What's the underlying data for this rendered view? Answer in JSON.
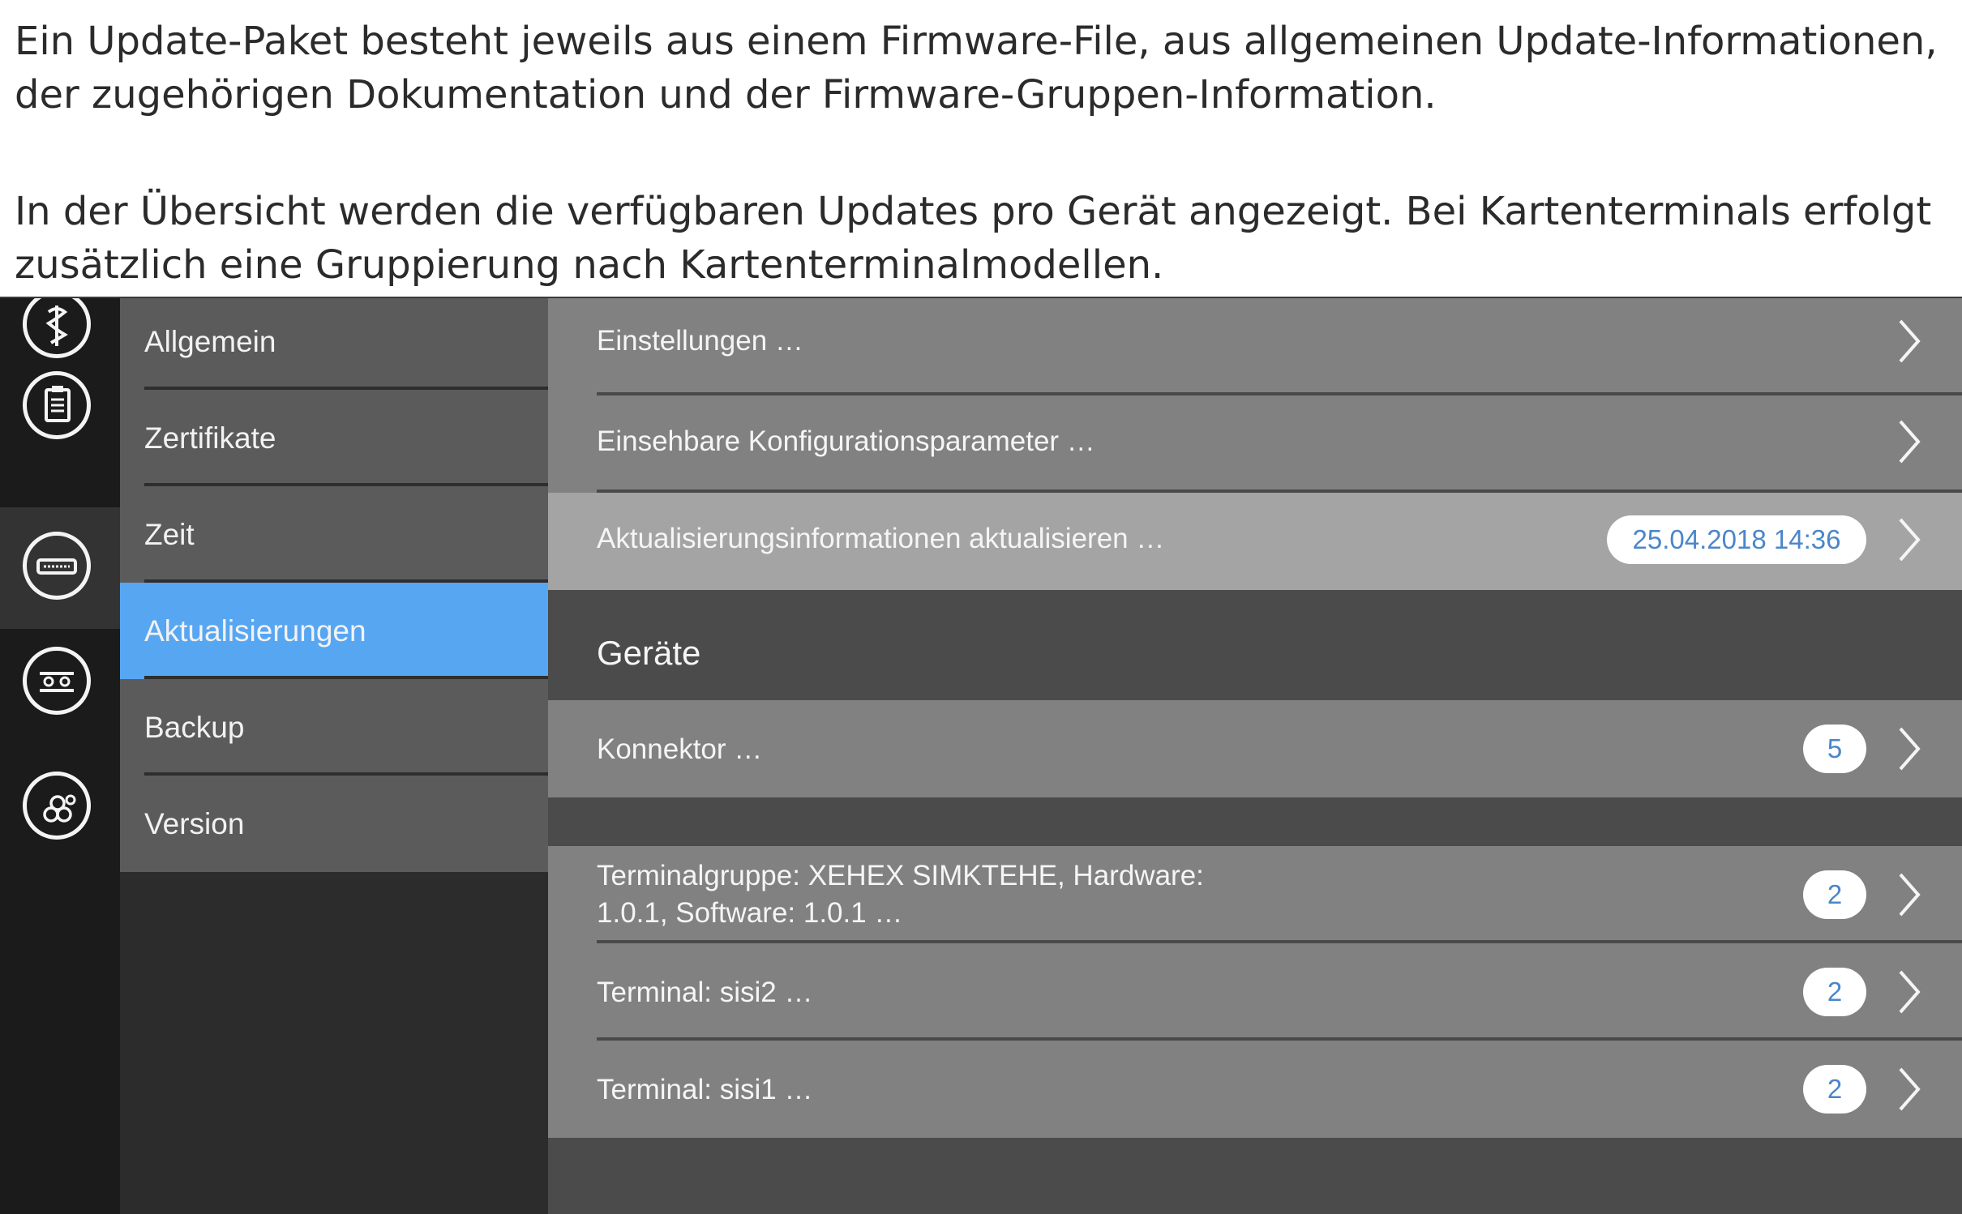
{
  "intro": {
    "paragraph1": "Ein Update-Paket besteht jeweils aus einem Firmware-File, aus allgemeinen Update-Informationen, der zugehörigen Dokumentation und der Firmware-Gruppen-Information.",
    "paragraph1_line1": "Ein Update-Paket besteht jeweils aus einem Firmware-File, aus allgemeinen Update-Informationen,",
    "paragraph1_line2": "der zugehörigen Dokumentation und der Firmware-Gruppen-Information.",
    "paragraph2_line1": "In der Übersicht werden die verfügbaren Updates pro Gerät angezeigt. Bei Kartenterminals erfolgt",
    "paragraph2_line2": "zusätzlich eine Gruppierung nach Kartenterminalmodellen."
  },
  "iconbar": {
    "items": [
      {
        "icon": "caduceus-icon"
      },
      {
        "icon": "clipboard-icon"
      },
      {
        "icon": "connector-device-icon",
        "active": true
      },
      {
        "icon": "toggle-settings-icon"
      },
      {
        "icon": "hexagon-nodes-icon"
      }
    ]
  },
  "menu": {
    "items": [
      {
        "label": "Allgemein"
      },
      {
        "label": "Zertifikate"
      },
      {
        "label": "Zeit"
      },
      {
        "label": "Aktualisierungen",
        "active": true
      },
      {
        "label": "Backup"
      },
      {
        "label": "Version"
      }
    ]
  },
  "content": {
    "rows": [
      {
        "label": "Einstellungen …"
      },
      {
        "label": "Einsehbare Konfigurationsparameter …"
      },
      {
        "label": "Aktualisierungsinformationen aktualisieren …",
        "badge": "25.04.2018 14:36"
      }
    ],
    "section_title": "Geräte",
    "device_rows": [
      {
        "label": "Konnektor …",
        "badge": "5"
      },
      {
        "label_line1": "Terminalgruppe: XEHEX SIMKTEHE, Hardware:",
        "label_line2": "1.0.1, Software: 1.0.1 …",
        "badge": "2"
      },
      {
        "label": "Terminal: sisi2 …",
        "badge": "2"
      },
      {
        "label": "Terminal: sisi1 …",
        "badge": "2"
      }
    ]
  },
  "colors": {
    "accent_blue": "#57a6f2",
    "badge_text": "#4b86c9"
  }
}
